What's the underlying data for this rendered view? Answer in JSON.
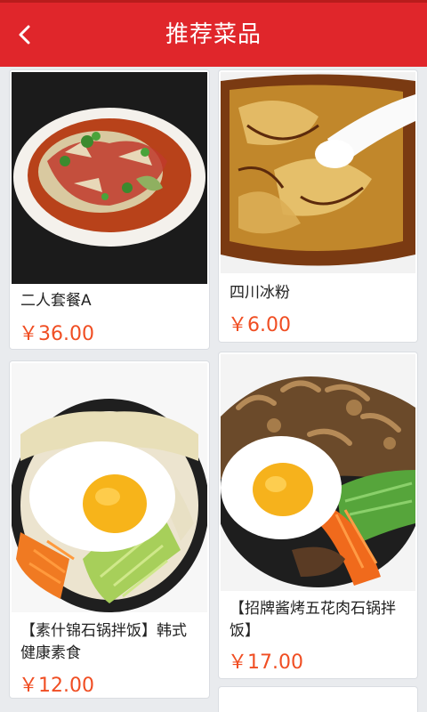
{
  "header": {
    "title": "推荐菜品",
    "back_icon": "chevron-left-icon"
  },
  "colors": {
    "header_bg": "#e0262b",
    "price": "#f04e23",
    "background": "#e9ebee"
  },
  "dishes": [
    {
      "name": "二人套餐A",
      "price": "￥36.00"
    },
    {
      "name": "四川冰粉",
      "price": "￥6.00"
    },
    {
      "name": "【素什锦石锅拌饭】韩式健康素食",
      "price": "￥12.00"
    },
    {
      "name": "【招牌酱烤五花肉石锅拌饭】",
      "price": "￥17.00"
    }
  ]
}
